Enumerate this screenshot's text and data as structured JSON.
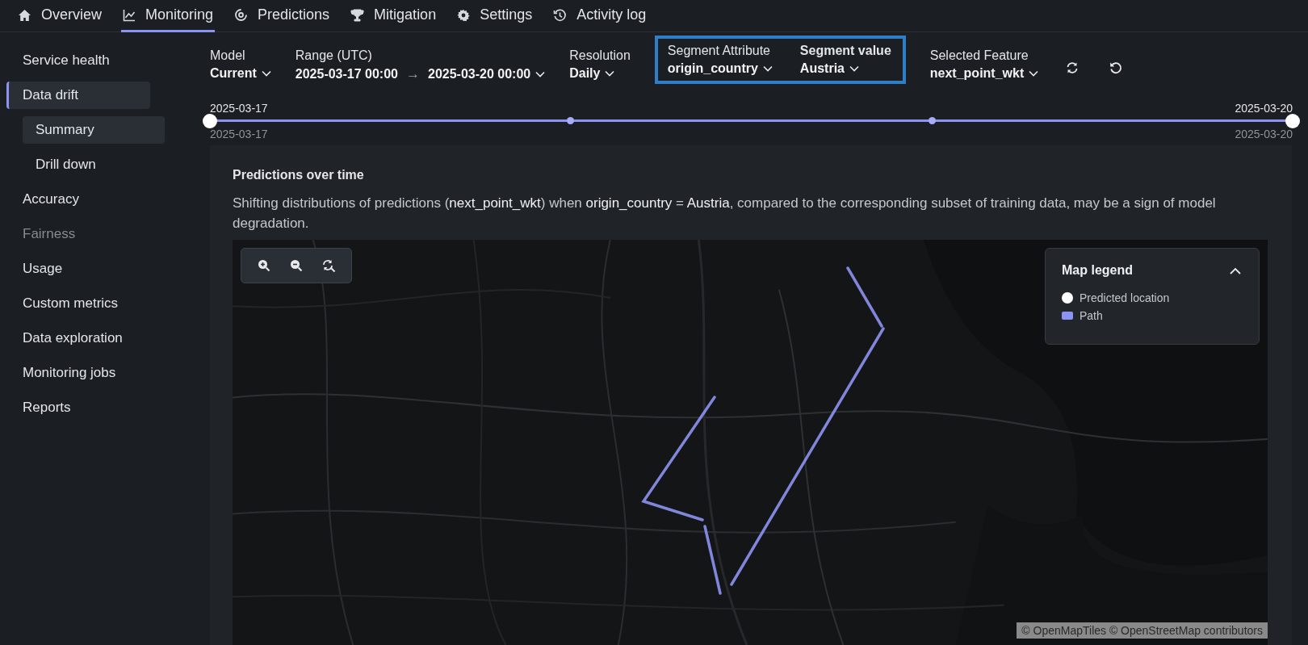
{
  "nav": {
    "tabs": [
      {
        "kind": "home",
        "label": "Overview",
        "selected": false
      },
      {
        "kind": "chart",
        "label": "Monitoring",
        "selected": true
      },
      {
        "kind": "predict",
        "label": "Predictions",
        "selected": false
      },
      {
        "kind": "trophy",
        "label": "Mitigation",
        "selected": false
      },
      {
        "kind": "gear",
        "label": "Settings",
        "selected": false
      },
      {
        "kind": "history",
        "label": "Activity log",
        "selected": false
      }
    ]
  },
  "sidebar": {
    "items": [
      {
        "label": "Service health",
        "selected": false,
        "disabled": false
      },
      {
        "label": "Data drift",
        "selected": true,
        "disabled": false,
        "children": [
          {
            "label": "Summary",
            "selected": true,
            "disabled": false
          },
          {
            "label": "Drill down",
            "selected": false,
            "disabled": false
          }
        ]
      },
      {
        "label": "Accuracy",
        "selected": false,
        "disabled": false
      },
      {
        "label": "Fairness",
        "selected": false,
        "disabled": true
      },
      {
        "label": "Usage",
        "selected": false,
        "disabled": false
      },
      {
        "label": "Custom metrics",
        "selected": false,
        "disabled": false
      },
      {
        "label": "Data exploration",
        "selected": false,
        "disabled": false
      },
      {
        "label": "Monitoring jobs",
        "selected": false,
        "disabled": false
      },
      {
        "label": "Reports",
        "selected": false,
        "disabled": false
      }
    ]
  },
  "filters": [
    {
      "kind": "single",
      "label": "Model",
      "value": "Current"
    },
    {
      "kind": "range",
      "label": "Range (UTC)",
      "from": "2025-03-17  00:00",
      "arrow": "→",
      "to": "2025-03-20  00:00"
    },
    {
      "kind": "single",
      "label": "Resolution",
      "value": "Daily"
    },
    {
      "kind": "group",
      "highlighted": true,
      "items": [
        {
          "label": "Segment Attribute",
          "value": "origin_country",
          "emphasized": false
        },
        {
          "label": "Segment value",
          "value": "Austria",
          "emphasized": true
        }
      ]
    },
    {
      "kind": "single",
      "label": "Selected Feature",
      "value": "next_point_wkt"
    },
    {
      "kind": "refresh"
    },
    {
      "kind": "reset"
    }
  ],
  "timeline": {
    "handles": [
      {
        "level": 0,
        "label_above": "2025-03-17",
        "label_below": "2025-03-17"
      },
      {
        "level": 1,
        "label_above": "2025-03-20",
        "label_below": "2025-03-20"
      }
    ],
    "marks": [
      {
        "level": 0.3333
      },
      {
        "level": 0.6667
      }
    ]
  },
  "card": {
    "title": "Predictions over time",
    "description": "Shifting distributions of predictions (**next_point_wkt**) when **origin_country** = **Austria**, compared to the corresponding subset of training data, may be a sign of model degradation.",
    "map": {
      "kind": "picture",
      "controls": [
        {
          "kind": "zoom-in"
        },
        {
          "kind": "zoom-out"
        },
        {
          "kind": "reset"
        }
      ],
      "legend": {
        "title": "Map legend",
        "expanded": true,
        "items": [
          {
            "kind": "point",
            "label": "Predicted location",
            "color": "#ffffff"
          },
          {
            "kind": "path",
            "label": "Path",
            "color": "#8c93f2"
          }
        ]
      },
      "attribution": "© OpenMapTiles © OpenStreetMap contributors"
    }
  }
}
